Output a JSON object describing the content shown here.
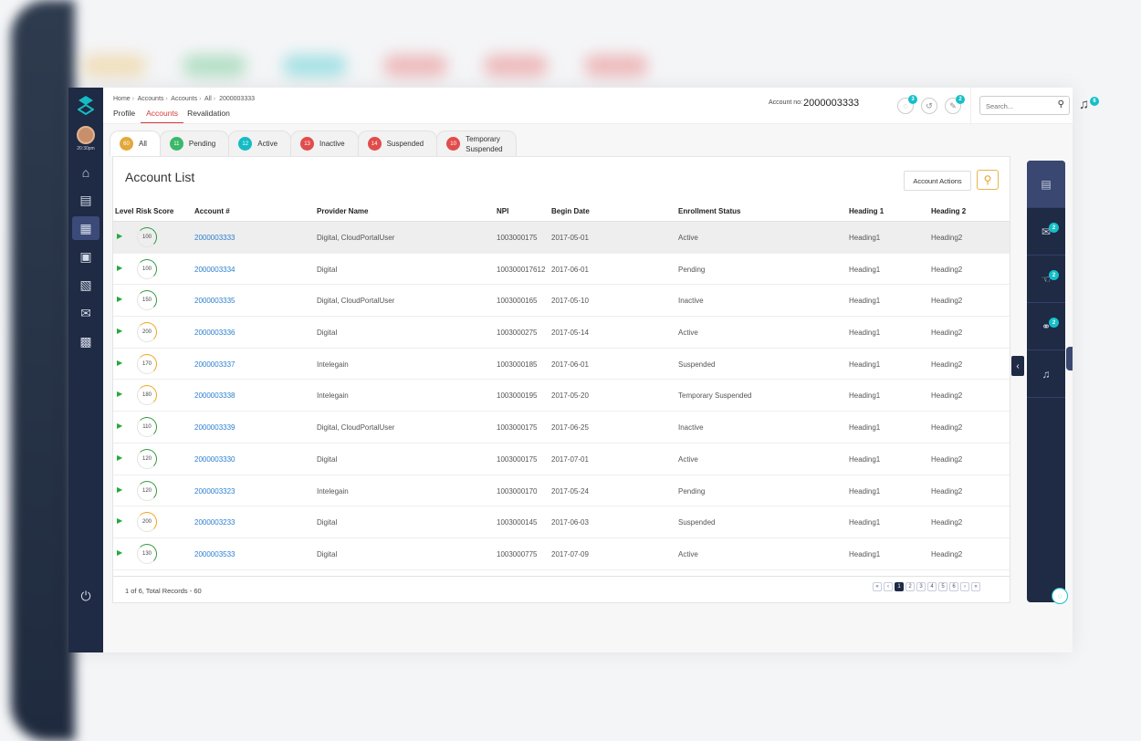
{
  "breadcrumb": [
    "Home",
    "Accounts",
    "Accounts",
    "All",
    "2000003333"
  ],
  "subnav": [
    "Profile",
    "Accounts",
    "Revalidation"
  ],
  "account_label": "Account no:",
  "account_no": "2000003333",
  "top_badges": {
    "comments": "3",
    "edit": "2",
    "bell": "6"
  },
  "time": "20:30pm",
  "search_placeholder": "Search...",
  "tabs": [
    {
      "count": "60",
      "label": "All",
      "color": "#e3a83b"
    },
    {
      "count": "11",
      "label": "Pending",
      "color": "#3bb86a"
    },
    {
      "count": "12",
      "label": "Active",
      "color": "#14bcc4"
    },
    {
      "count": "13",
      "label": "Inactive",
      "color": "#e24c4c"
    },
    {
      "count": "14",
      "label": "Suspended",
      "color": "#e24c4c"
    },
    {
      "count": "10",
      "label": "Temporary Suspended",
      "label_1": "Temporary",
      "label_2": "Suspended",
      "color": "#e24c4c"
    }
  ],
  "panel_title": "Account List",
  "actions_label": "Account Actions",
  "columns": [
    "Level",
    "Risk Score",
    "Account #",
    "Provider Name",
    "NPI",
    "Begin Date",
    "Enrollment Status",
    "Heading 1",
    "Heading 2"
  ],
  "rows": [
    {
      "score": "100",
      "score_color": "green",
      "account": "2000003333",
      "provider": "Digital, CloudPortalUser",
      "npi": "1003000175",
      "date": "2017-05-01",
      "status": "Active",
      "h1": "Heading1",
      "h2": "Heading2"
    },
    {
      "score": "100",
      "score_color": "green",
      "account": "2000003334",
      "provider": "Digital",
      "npi": "100300017612",
      "date": "2017-06-01",
      "status": "Pending",
      "h1": "Heading1",
      "h2": "Heading2"
    },
    {
      "score": "150",
      "score_color": "green",
      "account": "2000003335",
      "provider": "Digital, CloudPortalUser",
      "npi": "1003000165",
      "date": "2017-05-10",
      "status": "Inactive",
      "h1": "Heading1",
      "h2": "Heading2"
    },
    {
      "score": "200",
      "score_color": "orange",
      "account": "2000003336",
      "provider": "Digital",
      "npi": "1003000275",
      "date": "2017-05-14",
      "status": "Active",
      "h1": "Heading1",
      "h2": "Heading2"
    },
    {
      "score": "170",
      "score_color": "orange",
      "account": "2000003337",
      "provider": "Intelegain",
      "npi": "1003000185",
      "date": "2017-06-01",
      "status": "Suspended",
      "h1": "Heading1",
      "h2": "Heading2"
    },
    {
      "score": "180",
      "score_color": "orange",
      "account": "2000003338",
      "provider": "Intelegain",
      "npi": "1003000195",
      "date": "2017-05-20",
      "status": "Temporary Suspended",
      "h1": "Heading1",
      "h2": "Heading2"
    },
    {
      "score": "110",
      "score_color": "green",
      "account": "2000003339",
      "provider": "Digital, CloudPortalUser",
      "npi": "1003000175",
      "date": "2017-06-25",
      "status": "Inactive",
      "h1": "Heading1",
      "h2": "Heading2"
    },
    {
      "score": "120",
      "score_color": "green",
      "account": "2000003330",
      "provider": "Digital",
      "npi": "1003000175",
      "date": "2017-07-01",
      "status": "Active",
      "h1": "Heading1",
      "h2": "Heading2"
    },
    {
      "score": "120",
      "score_color": "green",
      "account": "2000003323",
      "provider": "Intelegain",
      "npi": "1003000170",
      "date": "2017-05-24",
      "status": "Pending",
      "h1": "Heading1",
      "h2": "Heading2"
    },
    {
      "score": "200",
      "score_color": "orange",
      "account": "2000003233",
      "provider": "Digital",
      "npi": "1003000145",
      "date": "2017-06-03",
      "status": "Suspended",
      "h1": "Heading1",
      "h2": "Heading2"
    },
    {
      "score": "130",
      "score_color": "green",
      "account": "2000003533",
      "provider": "Digital",
      "npi": "1003000775",
      "date": "2017-07-09",
      "status": "Active",
      "h1": "Heading1",
      "h2": "Heading2"
    }
  ],
  "records_text": "1 of 6, Total Records - 60",
  "pages": [
    "«",
    "‹",
    "1",
    "2",
    "3",
    "4",
    "5",
    "6",
    "›",
    "»"
  ],
  "right_badges": [
    "2",
    "2",
    "2"
  ]
}
